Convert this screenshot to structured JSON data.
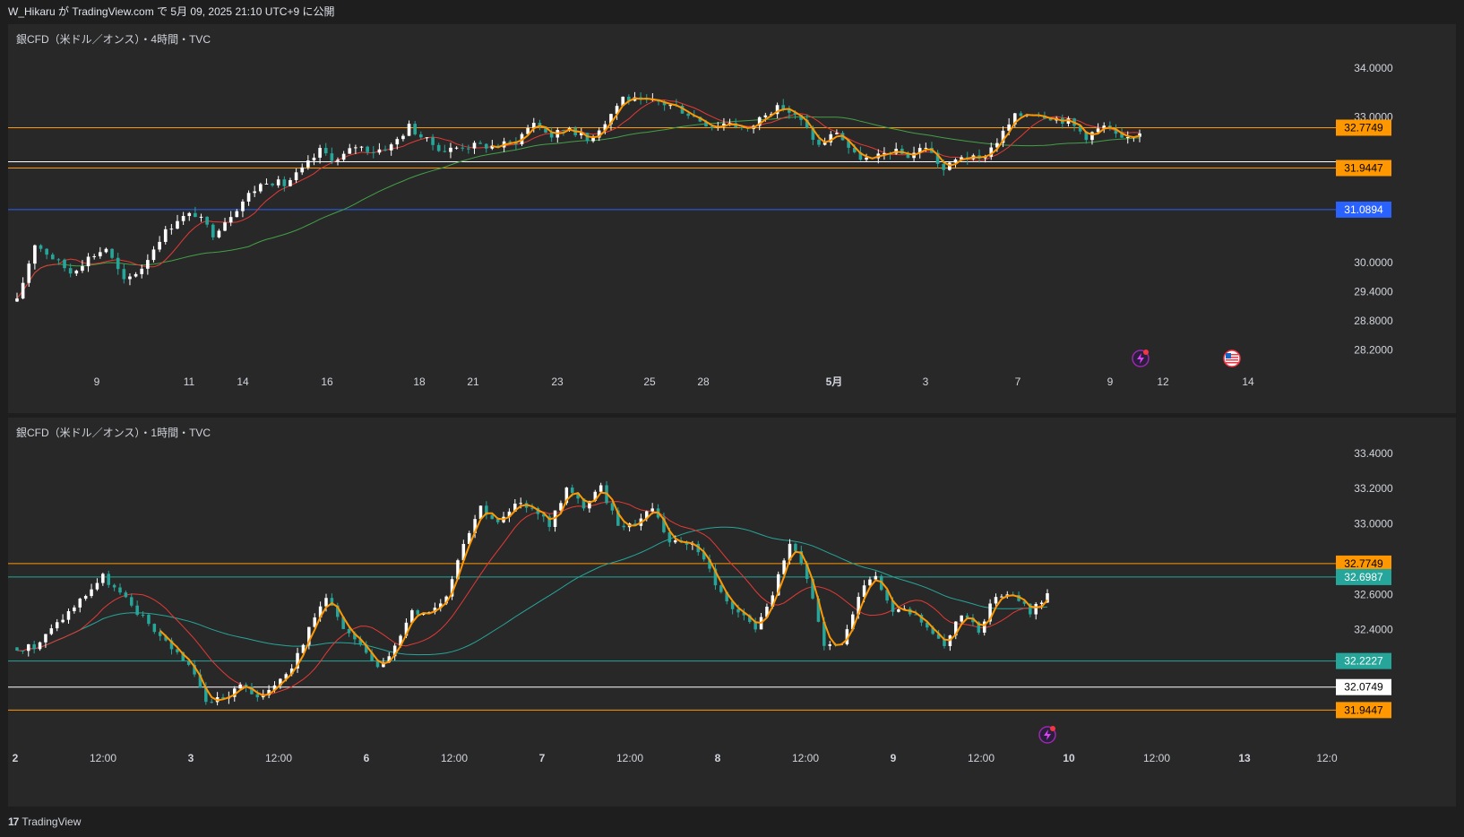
{
  "header": {
    "publish_text": "W_Hikaru が TradingView.com で 5月 09, 2025 21:10 UTC+9 に公開"
  },
  "footer": {
    "brand": "TradingView"
  },
  "icons": {
    "alert": "lightning-icon",
    "flag": "us-flag-icon",
    "logo": "tradingview-logo-icon"
  },
  "colors": {
    "background": "#282828",
    "up_candle": "#ffffff",
    "down_candle": "#26a69a",
    "ma_fast": "#ff9800",
    "ma_mid": "#e53935",
    "ma_slow_4h": "#43a047",
    "ma_slow_1h": "#26a69a",
    "level_orange": "#ff9800",
    "level_white": "#ffffff",
    "level_blue": "#2962ff",
    "level_teal": "#26a69a"
  },
  "chart_data": [
    {
      "type": "candlestick",
      "title": "銀CFD（米ドル／オンス）・4時間・TVC",
      "ylim": [
        27.9,
        34.35
      ],
      "y_ticks": [
        "34.0000",
        "33.0000",
        "30.0000",
        "29.4000",
        "28.8000",
        "28.2000"
      ],
      "x_ticks": [
        "9",
        "11",
        "14",
        "16",
        "18",
        "21",
        "23",
        "25",
        "28",
        "5月",
        "3",
        "7",
        "9",
        "12",
        "14"
      ],
      "x_ticks_bold": [
        "5月"
      ],
      "levels": [
        {
          "value": 32.7749,
          "label": "32.7749",
          "color": "#ff9800",
          "text_color": "#000000"
        },
        {
          "value": 31.9447,
          "label": "31.9447",
          "color": "#ff9800",
          "text_color": "#000000"
        },
        {
          "value": 31.0894,
          "label": "31.0894",
          "color": "#2962ff",
          "text_color": "#ffffff"
        },
        {
          "value": 32.0749,
          "label": "",
          "color": "#ffffff",
          "text_color": "#000000"
        }
      ],
      "close_path": [
        [
          0,
          29.2
        ],
        [
          3,
          30.4
        ],
        [
          6,
          30.1
        ],
        [
          9,
          29.8
        ],
        [
          12,
          30.1
        ],
        [
          15,
          30.3
        ],
        [
          18,
          29.6
        ],
        [
          21,
          29.9
        ],
        [
          24,
          30.5
        ],
        [
          27,
          30.9
        ],
        [
          30,
          31.0
        ],
        [
          33,
          30.6
        ],
        [
          36,
          31.0
        ],
        [
          39,
          31.4
        ],
        [
          42,
          31.7
        ],
        [
          45,
          31.6
        ],
        [
          48,
          31.9
        ],
        [
          51,
          32.3
        ],
        [
          54,
          32.1
        ],
        [
          57,
          32.4
        ],
        [
          60,
          32.3
        ],
        [
          63,
          32.4
        ],
        [
          66,
          32.8
        ],
        [
          69,
          32.5
        ],
        [
          72,
          32.3
        ],
        [
          75,
          32.4
        ],
        [
          78,
          32.4
        ],
        [
          81,
          32.4
        ],
        [
          84,
          32.5
        ],
        [
          87,
          32.9
        ],
        [
          90,
          32.6
        ],
        [
          93,
          32.8
        ],
        [
          96,
          32.5
        ],
        [
          99,
          32.9
        ],
        [
          102,
          33.4
        ],
        [
          105,
          33.3
        ],
        [
          108,
          33.3
        ],
        [
          111,
          33.2
        ],
        [
          114,
          33.0
        ],
        [
          117,
          32.8
        ],
        [
          120,
          32.9
        ],
        [
          123,
          32.7
        ],
        [
          126,
          33.1
        ],
        [
          129,
          33.2
        ],
        [
          132,
          32.9
        ],
        [
          135,
          32.4
        ],
        [
          138,
          32.7
        ],
        [
          141,
          32.2
        ],
        [
          144,
          32.1
        ],
        [
          147,
          32.3
        ],
        [
          150,
          32.2
        ],
        [
          153,
          32.4
        ],
        [
          156,
          31.9
        ],
        [
          159,
          32.2
        ],
        [
          162,
          32.1
        ],
        [
          165,
          32.5
        ],
        [
          168,
          33.0
        ],
        [
          171,
          33.1
        ],
        [
          174,
          33.0
        ],
        [
          177,
          32.9
        ],
        [
          180,
          32.6
        ],
        [
          183,
          32.8
        ],
        [
          186,
          32.5
        ],
        [
          189,
          32.7
        ]
      ],
      "series": [
        {
          "name": "",
          "color": "#ff9800"
        },
        {
          "name": "",
          "color": "#e53935"
        },
        {
          "name": "",
          "color": "#43a047"
        }
      ]
    },
    {
      "type": "candlestick",
      "title": "銀CFD（米ドル／オンス）・1時間・TVC",
      "ylim": [
        31.85,
        33.45
      ],
      "y_ticks": [
        "33.4000",
        "33.2000",
        "33.0000",
        "32.6000",
        "32.4000"
      ],
      "x_ticks": [
        "2",
        "12:00",
        "3",
        "12:00",
        "6",
        "12:00",
        "7",
        "12:00",
        "8",
        "12:00",
        "9",
        "12:00",
        "10",
        "12:00",
        "13",
        "12:0"
      ],
      "x_ticks_bold": [
        "2",
        "3",
        "6",
        "7",
        "8",
        "9",
        "10",
        "13"
      ],
      "levels": [
        {
          "value": 32.7749,
          "label": "32.7749",
          "color": "#ff9800",
          "text_color": "#000000"
        },
        {
          "value": 32.6987,
          "label": "32.6987",
          "color": "#26a69a",
          "text_color": "#ffffff"
        },
        {
          "value": 32.2227,
          "label": "32.2227",
          "color": "#26a69a",
          "text_color": "#ffffff"
        },
        {
          "value": 32.0749,
          "label": "32.0749",
          "color": "#ffffff",
          "text_color": "#000000"
        },
        {
          "value": 31.9447,
          "label": "31.9447",
          "color": "#ff9800",
          "text_color": "#000000"
        }
      ],
      "close_path": [
        [
          0,
          32.3
        ],
        [
          3,
          32.3
        ],
        [
          6,
          32.4
        ],
        [
          9,
          32.5
        ],
        [
          12,
          32.6
        ],
        [
          15,
          32.7
        ],
        [
          18,
          32.6
        ],
        [
          21,
          32.5
        ],
        [
          24,
          32.4
        ],
        [
          27,
          32.3
        ],
        [
          30,
          32.2
        ],
        [
          33,
          32.0
        ],
        [
          36,
          32.0
        ],
        [
          39,
          32.1
        ],
        [
          42,
          32.0
        ],
        [
          45,
          32.1
        ],
        [
          48,
          32.2
        ],
        [
          51,
          32.4
        ],
        [
          54,
          32.6
        ],
        [
          57,
          32.4
        ],
        [
          60,
          32.3
        ],
        [
          63,
          32.2
        ],
        [
          66,
          32.3
        ],
        [
          69,
          32.5
        ],
        [
          72,
          32.5
        ],
        [
          75,
          32.6
        ],
        [
          78,
          32.9
        ],
        [
          81,
          33.1
        ],
        [
          84,
          33.0
        ],
        [
          87,
          33.1
        ],
        [
          90,
          33.1
        ],
        [
          93,
          33.0
        ],
        [
          96,
          33.2
        ],
        [
          99,
          33.1
        ],
        [
          102,
          33.2
        ],
        [
          105,
          33.0
        ],
        [
          108,
          33.0
        ],
        [
          111,
          33.1
        ],
        [
          114,
          32.9
        ],
        [
          117,
          32.9
        ],
        [
          120,
          32.8
        ],
        [
          123,
          32.6
        ],
        [
          126,
          32.5
        ],
        [
          129,
          32.4
        ],
        [
          132,
          32.6
        ],
        [
          135,
          32.9
        ],
        [
          138,
          32.7
        ],
        [
          141,
          32.3
        ],
        [
          144,
          32.3
        ],
        [
          147,
          32.6
        ],
        [
          150,
          32.7
        ],
        [
          153,
          32.5
        ],
        [
          156,
          32.5
        ],
        [
          159,
          32.4
        ],
        [
          162,
          32.3
        ],
        [
          165,
          32.5
        ],
        [
          168,
          32.4
        ],
        [
          171,
          32.6
        ],
        [
          174,
          32.6
        ],
        [
          177,
          32.5
        ],
        [
          180,
          32.6
        ]
      ],
      "series": [
        {
          "name": "",
          "color": "#ff9800"
        },
        {
          "name": "",
          "color": "#e53935"
        },
        {
          "name": "",
          "color": "#26a69a"
        }
      ]
    }
  ]
}
